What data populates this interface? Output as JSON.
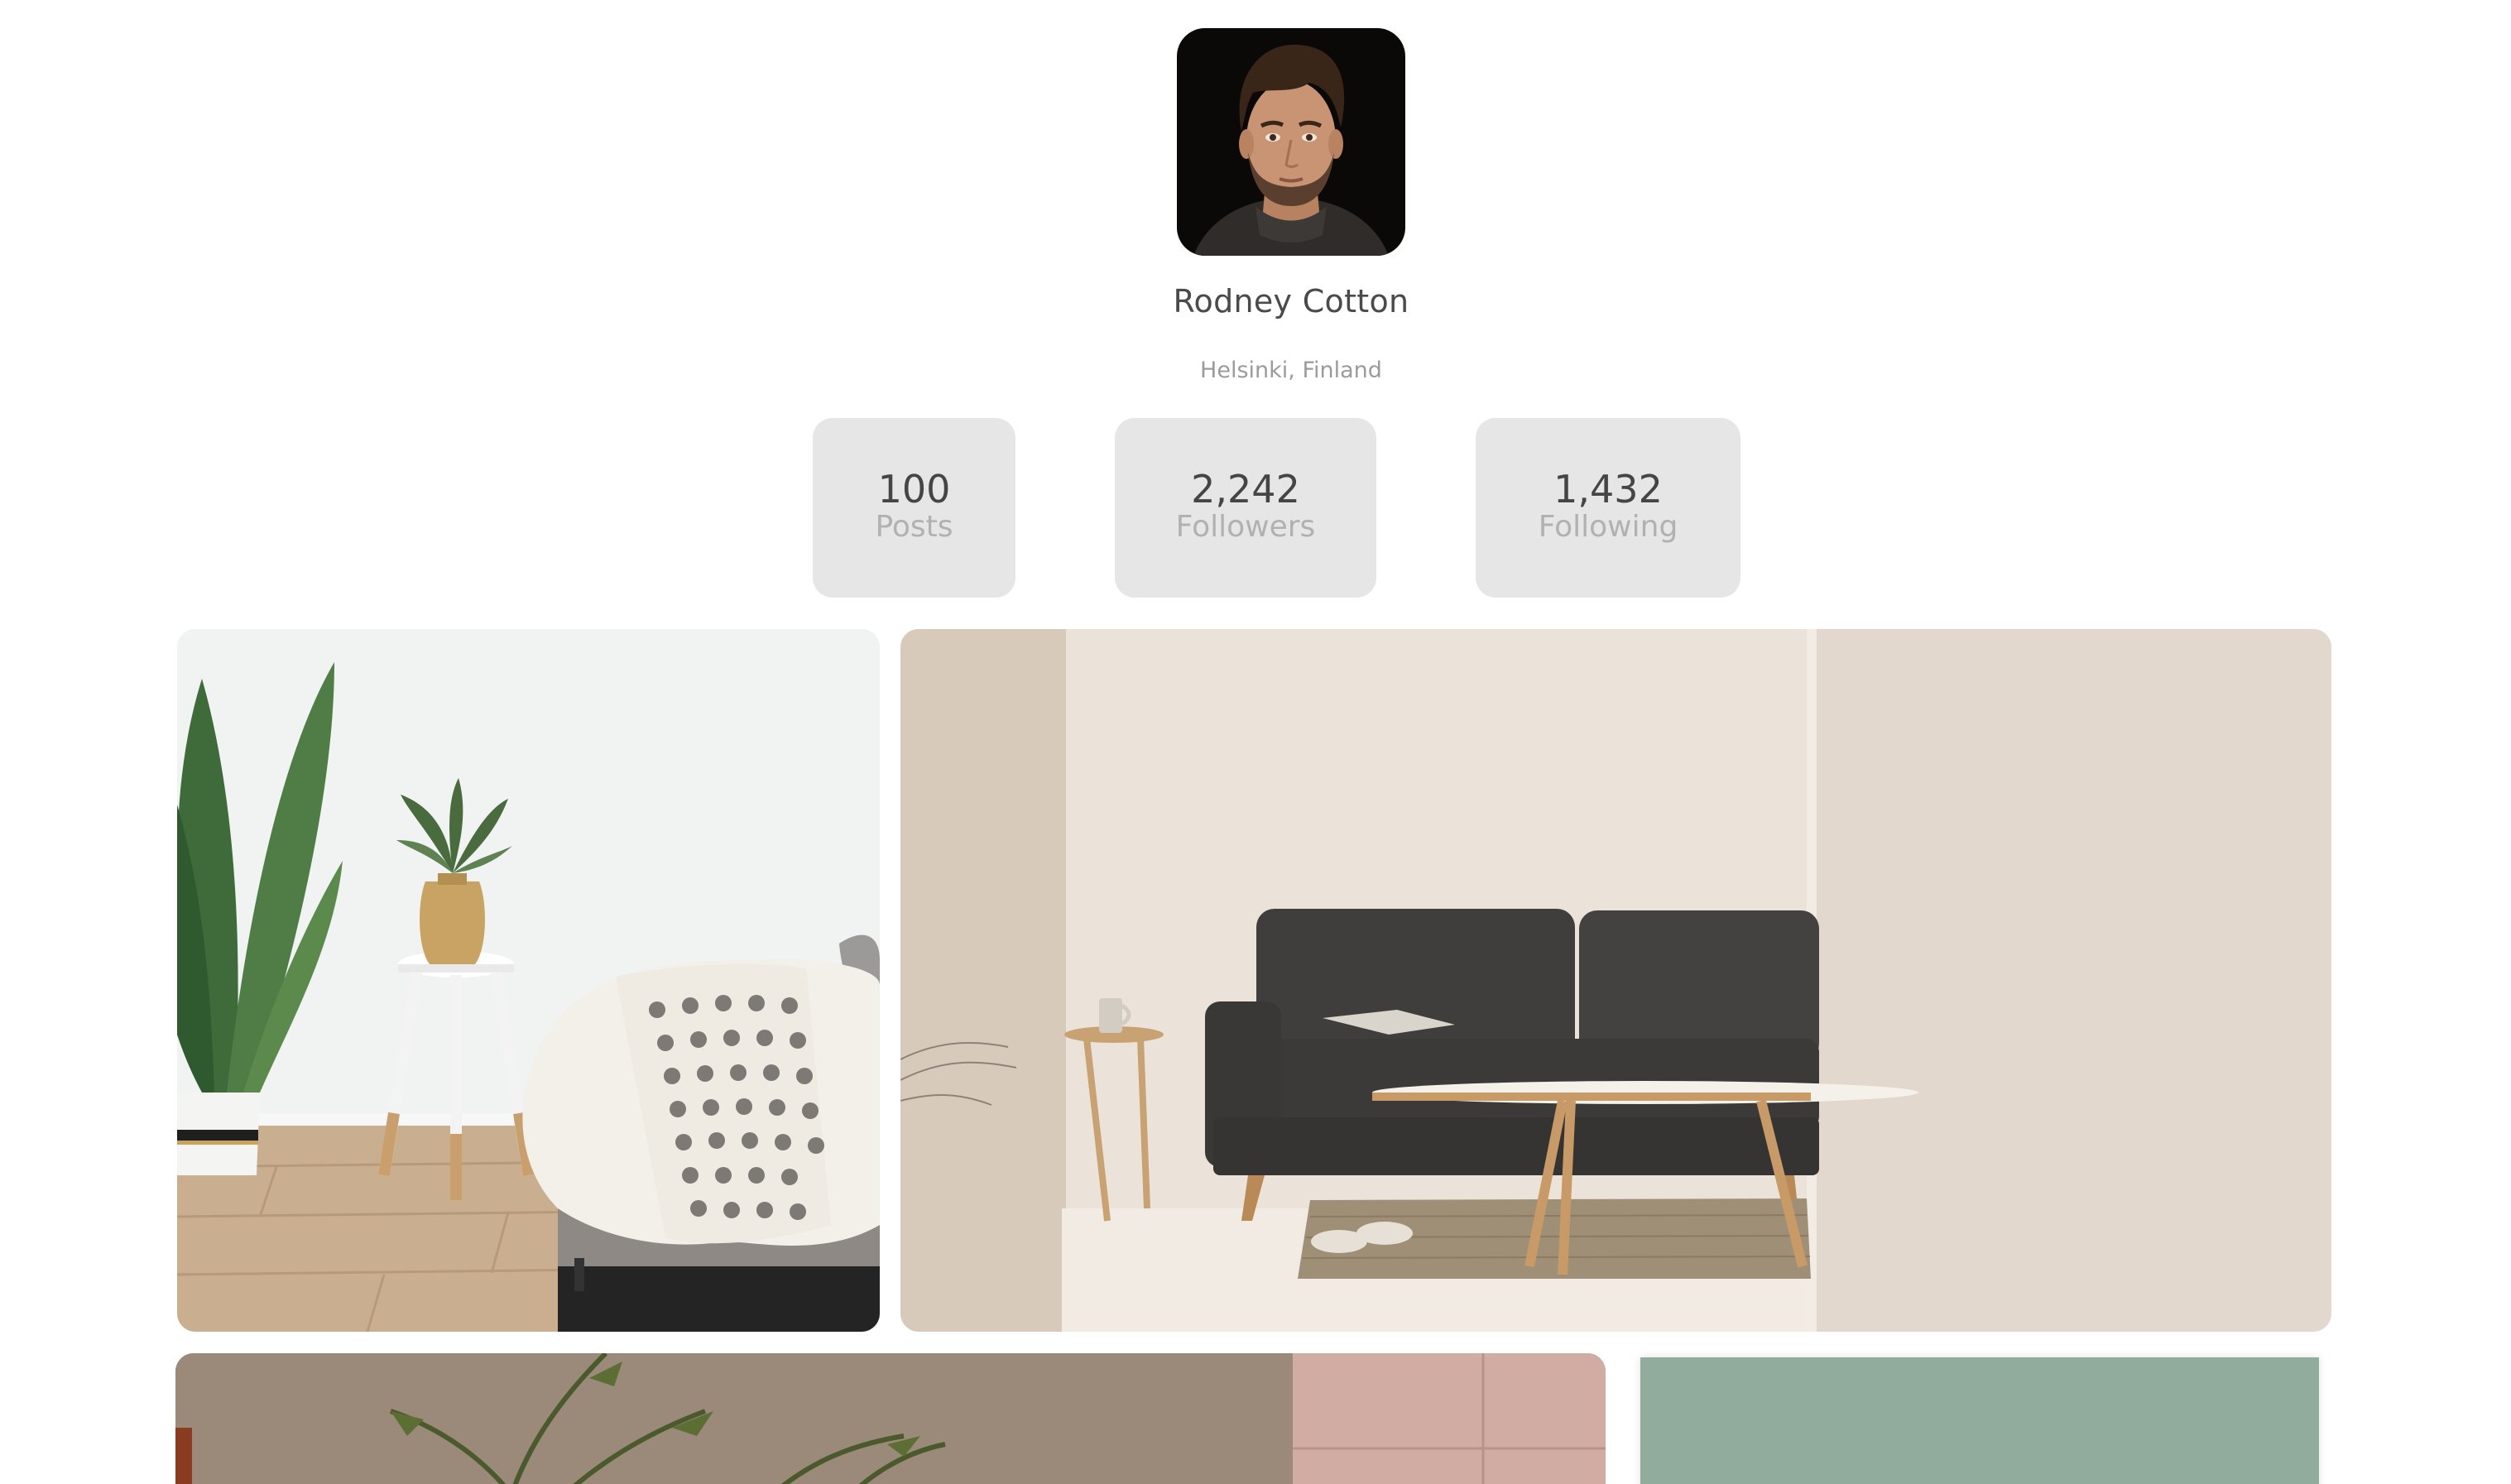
{
  "profile": {
    "name": "Rodney Cotton",
    "location": "Helsinki, Finland",
    "avatar_alt": "Profile photo of Rodney Cotton"
  },
  "stats": [
    {
      "value": "100",
      "label": "Posts"
    },
    {
      "value": "2,242",
      "label": "Followers"
    },
    {
      "value": "1,432",
      "label": "Following"
    }
  ],
  "gallery": {
    "photos": [
      {
        "description": "Living room corner with plant, side table and couch with blanket"
      },
      {
        "description": "Minimal living room with dark grey sofa and coffee table"
      },
      {
        "description": "Textured wall with palm leaves and pink tiles"
      },
      {
        "description": "Sage green textured wall"
      }
    ]
  },
  "colors": {
    "card_background": "#e6e6e6",
    "name_text": "#4a4a4a",
    "muted_text": "#9b9b9b",
    "stat_label": "#b1b1b1"
  }
}
